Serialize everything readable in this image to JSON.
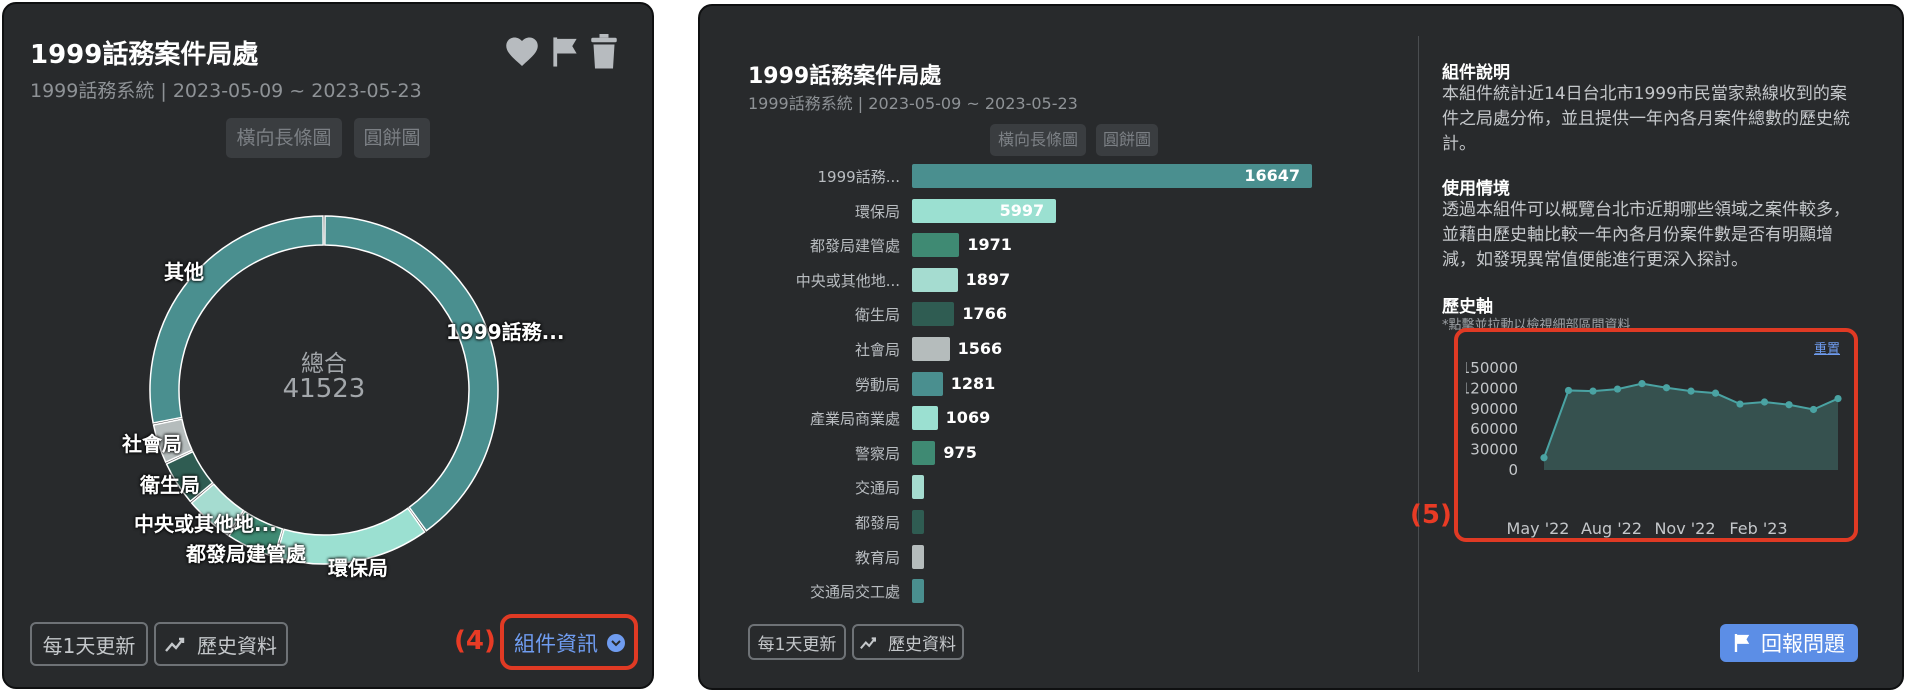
{
  "left_panel": {
    "title": "1999話務案件局處",
    "subtitle": "1999話務系統 | 2023-05-09 ~ 2023-05-23",
    "toggles": [
      "橫向長條圖",
      "圓餅圖"
    ],
    "icons": [
      "heart-icon",
      "flag-icon",
      "trash-icon"
    ],
    "donut": {
      "center_label": "總合",
      "center_value": "41523",
      "labels": {
        "other": "其他",
        "top": "1999話務...",
        "social": "社會局",
        "health": "衛生局",
        "central": "中央或其他地...",
        "urban": "都發局建管處",
        "env": "環保局"
      }
    },
    "update_label": "每1天更新",
    "history_label": "歷史資料",
    "info_label": "組件資訊",
    "annotation": "(4)"
  },
  "right_panel": {
    "title": "1999話務案件局處",
    "subtitle": "1999話務系統 | 2023-05-09 ~ 2023-05-23",
    "toggles": [
      "橫向長條圖",
      "圓餅圖"
    ],
    "update_label": "每1天更新",
    "history_label": "歷史資料",
    "desc_title": "組件說明",
    "desc_text": "本組件統計近14日台北市1999市民當家熱線收到的案件之局處分佈，並且提供一年內各月案件總數的歷史統計。",
    "usage_title": "使用情境",
    "usage_text": "透過本組件可以概覽台北市近期哪些領域之案件較多，並藉由歷史軸比較一年內各月份案件數是否有明顯增減，如發現異常值便能進行更深入探討。",
    "history_title": "歷史軸",
    "history_hint": "*點擊並拉動以檢視細部區間資料",
    "reset_label": "重置",
    "report_label": "回報問題",
    "annotation": "(5)"
  },
  "colors": {
    "teal": "#4a8f8f",
    "mint": "#9be0d1",
    "green": "#3f8a73",
    "pale": "#a5dcd0",
    "dark_green": "#2f5c52",
    "gray": "#b5bcbc",
    "report_blue": "#5c8ee6",
    "annotation_red": "#e03a24"
  },
  "chart_data": [
    {
      "type": "bar",
      "orientation": "horizontal",
      "categories": [
        "1999話務...",
        "環保局",
        "都發局建管處",
        "中央或其他地...",
        "衛生局",
        "社會局",
        "勞動局",
        "產業局商業處",
        "警察局",
        "交通局",
        "都發局",
        "教育局",
        "交通局交工處"
      ],
      "values": [
        16647,
        5997,
        1971,
        1897,
        1766,
        1566,
        1281,
        1069,
        975,
        320,
        260,
        240,
        200
      ],
      "value_labels": [
        "16647",
        "5997",
        "1971",
        "1897",
        "1766",
        "1566",
        "1281",
        "1069",
        "975",
        "",
        "",
        "",
        ""
      ],
      "colors": [
        "#4a8f8f",
        "#9be0d1",
        "#3f8a73",
        "#a5dcd0",
        "#2f5c52",
        "#b5bcbc",
        "#4a8f8f",
        "#9be0d1",
        "#3f8a73",
        "#a5dcd0",
        "#2f5c52",
        "#b5bcbc",
        "#4a8f8f"
      ]
    },
    {
      "type": "area",
      "x": [
        "May '22",
        "Jun '22",
        "Jul '22",
        "Aug '22",
        "Sep '22",
        "Oct '22",
        "Nov '22",
        "Dec '22",
        "Jan '23",
        "Feb '23",
        "Mar '23",
        "Apr '23",
        "May '23"
      ],
      "values": [
        18000,
        117000,
        116000,
        119000,
        127000,
        121000,
        116000,
        113000,
        97000,
        100000,
        96000,
        89000,
        105000
      ],
      "x_tick_labels": [
        "May '22",
        "Aug '22",
        "Nov '22",
        "Feb '23"
      ],
      "y_tick_labels": [
        "150000",
        "120000",
        "90000",
        "60000",
        "30000",
        "0"
      ],
      "ylim": [
        0,
        150000
      ]
    },
    {
      "type": "pie",
      "donut": true,
      "categories": [
        "1999話務...",
        "環保局",
        "都發局建管處",
        "中央或其他地...",
        "衛生局",
        "社會局",
        "其他"
      ],
      "values": [
        16647,
        5997,
        1971,
        1897,
        1766,
        1566,
        11679
      ],
      "colors": [
        "#4a8f8f",
        "#9be0d1",
        "#3f8a73",
        "#a5dcd0",
        "#2f5c52",
        "#b5bcbc",
        "#4a8f8f"
      ]
    }
  ]
}
